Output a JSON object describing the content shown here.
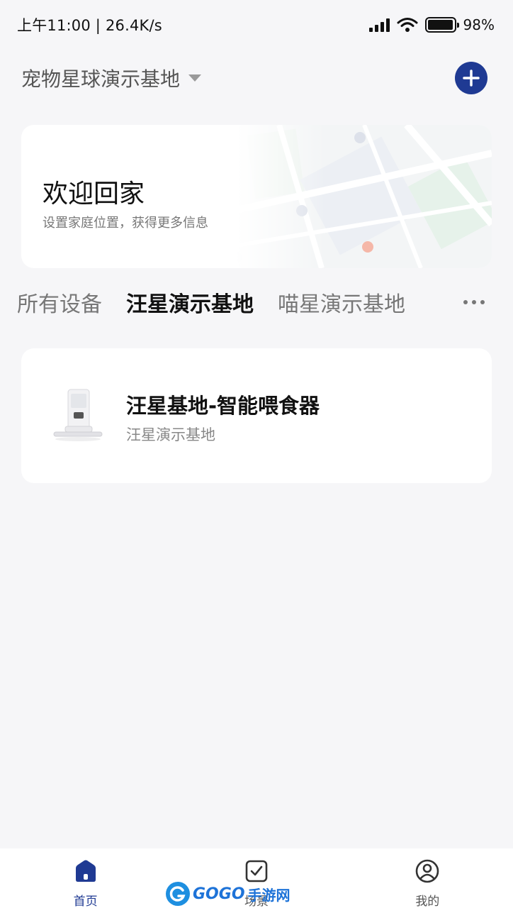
{
  "status_bar": {
    "time_speed": "上午11:00 | 26.4K/s",
    "battery_percent": 98,
    "battery_text": "98%"
  },
  "header": {
    "home_name": "宠物星球演示基地",
    "icons": {
      "dropdown": "caret-down-icon",
      "add": "plus-icon"
    }
  },
  "welcome": {
    "title": "欢迎回家",
    "subtitle": "设置家庭位置，获得更多信息"
  },
  "tabs": [
    {
      "label": "所有设备",
      "active": false
    },
    {
      "label": "汪星演示基地",
      "active": true
    },
    {
      "label": "喵星演示基地",
      "active": false
    }
  ],
  "devices": [
    {
      "name": "汪星基地-智能喂食器",
      "room": "汪星演示基地",
      "icon": "pet-feeder-image"
    }
  ],
  "bottom_nav": [
    {
      "label": "首页",
      "icon": "home-icon",
      "active": true
    },
    {
      "label": "场景",
      "icon": "checkbox-icon",
      "active": false
    },
    {
      "label": "我的",
      "icon": "profile-icon",
      "active": false
    }
  ],
  "watermark": {
    "brand": "GOGO",
    "suffix": "手游网"
  },
  "colors": {
    "accent": "#1f3a93",
    "background": "#f6f6f8",
    "card": "#ffffff"
  }
}
